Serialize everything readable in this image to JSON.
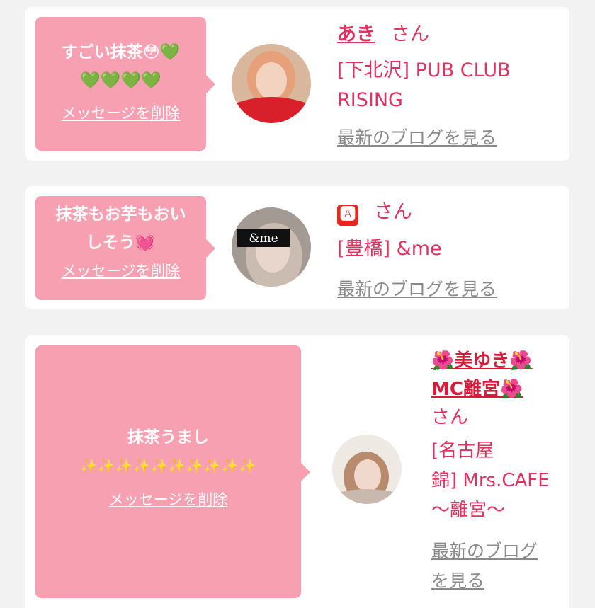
{
  "colors": {
    "bubble": "#f7a0b1",
    "accent": "#e0325f",
    "link_gray": "#8a8a8a",
    "background": "#f2f2f2"
  },
  "messages": [
    {
      "text_line1": "すごい抹茶😳💚",
      "text_line2": "💚💚💚💚",
      "delete_label": "メッセージを削除",
      "user_name": "あき",
      "honorific": "さん",
      "shop_line1": "[下北沢] PUB CLUB",
      "shop_line2": "RISING",
      "blog_label": "最新のブログを見る"
    },
    {
      "text_line1": "抹茶もお芋もおい",
      "text_line2": "しそう💓",
      "delete_label": "メッセージを削除",
      "user_name": "🅰",
      "honorific": "さん",
      "shop_line1": "[豊橋] &me",
      "blog_label": "最新のブログを見る",
      "avatar_text": "&me"
    },
    {
      "text_line1": "抹茶うまし",
      "text_line2": "✨✨✨✨✨✨✨✨✨✨",
      "delete_label": "メッセージを削除",
      "user_name_line1": "🌺美ゆき🌺",
      "user_name_line2": "MC離宮🌺",
      "honorific": "さん",
      "shop_line1": "[名古屋",
      "shop_line2": "錦] Mrs.CAFE",
      "shop_line3": "～離宮～",
      "blog_line1": "最新のブログ",
      "blog_line2": "を見る"
    }
  ]
}
